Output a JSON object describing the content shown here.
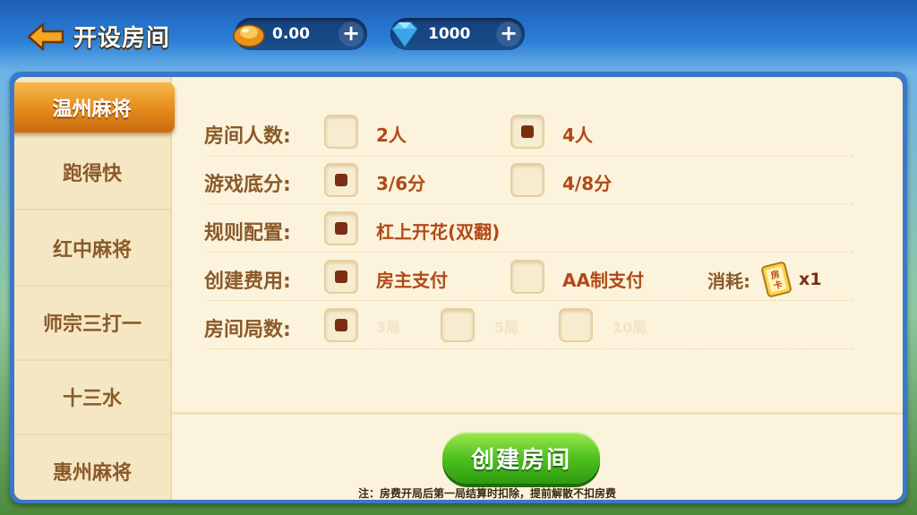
{
  "header": {
    "title": "开设房间",
    "gold_value": "0.00",
    "gem_value": "1000",
    "icons": [
      "back-arrow-icon",
      "gold-ingot-icon",
      "diamond-icon",
      "plus-icon"
    ]
  },
  "sidebar": {
    "items": [
      {
        "label": "温州麻将",
        "active": true
      },
      {
        "label": "跑得快"
      },
      {
        "label": "红中麻将"
      },
      {
        "label": "师宗三打一"
      },
      {
        "label": "十三水"
      },
      {
        "label": "惠州麻将"
      }
    ]
  },
  "settings": {
    "players": {
      "label": "房间人数:",
      "options": [
        {
          "text": "2人",
          "checked": false
        },
        {
          "text": "4人",
          "checked": true
        }
      ]
    },
    "base_score": {
      "label": "游戏底分:",
      "options": [
        {
          "text": "3/6分",
          "checked": true
        },
        {
          "text": "4/8分",
          "checked": false
        }
      ]
    },
    "rules": {
      "label": "规则配置:",
      "options": [
        {
          "text": "杠上开花(双翻)",
          "checked": true
        }
      ]
    },
    "fee": {
      "label": "创建费用:",
      "options": [
        {
          "text": "房主支付",
          "checked": true
        },
        {
          "text": "AA制支付",
          "checked": false
        }
      ],
      "consume_label": "消耗:",
      "card_icon_text": "房卡",
      "card_count": "x1"
    },
    "rounds": {
      "label": "房间局数:",
      "options": [
        {
          "text": "3局",
          "checked": true
        },
        {
          "text": "5局",
          "checked": false
        },
        {
          "text": "10局",
          "checked": false
        }
      ]
    }
  },
  "footer": {
    "create_button": "创建房间",
    "note": "注：房费开局后第一局结算时扣除，提前解散不扣房费"
  },
  "colors": {
    "accent_orange": "#e48a1c",
    "panel_bg": "#fcf3dc",
    "label_brown": "#8a5a2a",
    "option_red": "#b04a18",
    "button_green": "#4fc21f"
  }
}
